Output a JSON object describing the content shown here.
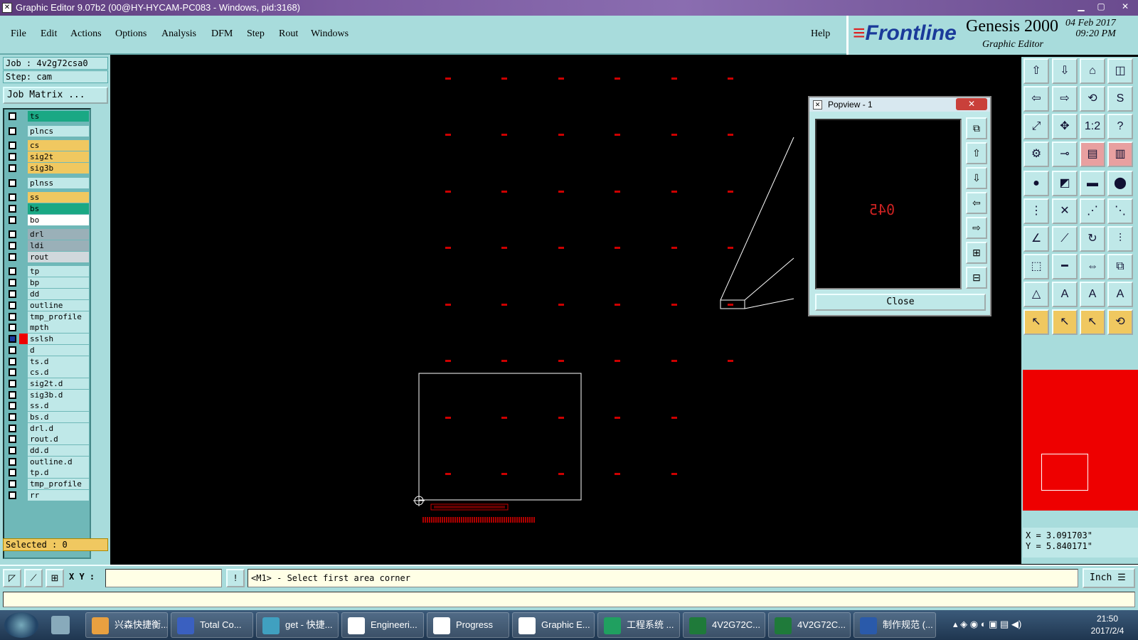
{
  "window": {
    "title": "Graphic Editor 9.07b2 (00@HY-HYCAM-PC083 - Windows, pid:3168)"
  },
  "menu": [
    "File",
    "Edit",
    "Actions",
    "Options",
    "Analysis",
    "DFM",
    "Step",
    "Rout",
    "Windows"
  ],
  "help_label": "Help",
  "brand": {
    "logo_prefix": "≡",
    "logo_text": "Frontline",
    "product": "Genesis 2000",
    "subtitle": "Graphic Editor",
    "date": "04 Feb 2017",
    "time": "09:20 PM"
  },
  "job": {
    "job_line": "Job : 4v2g72csa0",
    "step_line": "Step: cam",
    "matrix_button": "Job Matrix ..."
  },
  "layers": [
    {
      "name": "ts",
      "color": "#1aa884"
    },
    {
      "name": "plncs",
      "color": "#bfe8e8"
    },
    {
      "name": "cs",
      "color": "#f0c860"
    },
    {
      "name": "sig2t",
      "color": "#f0c860"
    },
    {
      "name": "sig3b",
      "color": "#f0c860"
    },
    {
      "name": "plnss",
      "color": "#bfe8e8"
    },
    {
      "name": "ss",
      "color": "#f0c860"
    },
    {
      "name": "bs",
      "color": "#1aa884"
    },
    {
      "name": "bo",
      "color": "#ffffff"
    },
    {
      "name": "drl",
      "color": "#9ab0b8"
    },
    {
      "name": "ldi",
      "color": "#9ab0b8"
    },
    {
      "name": "rout",
      "color": "#d0d8dc"
    },
    {
      "name": "tp",
      "color": "#bfe8e8"
    },
    {
      "name": "bp",
      "color": "#bfe8e8"
    },
    {
      "name": "dd",
      "color": "#bfe8e8"
    },
    {
      "name": "outline",
      "color": "#bfe8e8"
    },
    {
      "name": "tmp_profile",
      "color": "#bfe8e8"
    },
    {
      "name": "mpth",
      "color": "#bfe8e8"
    },
    {
      "name": "sslsh",
      "color": "#bfe8e8"
    },
    {
      "name": "d",
      "color": "#bfe8e8"
    },
    {
      "name": "ts.d",
      "color": "#bfe8e8"
    },
    {
      "name": "cs.d",
      "color": "#bfe8e8"
    },
    {
      "name": "sig2t.d",
      "color": "#bfe8e8"
    },
    {
      "name": "sig3b.d",
      "color": "#bfe8e8"
    },
    {
      "name": "ss.d",
      "color": "#bfe8e8"
    },
    {
      "name": "bs.d",
      "color": "#bfe8e8"
    },
    {
      "name": "drl.d",
      "color": "#bfe8e8"
    },
    {
      "name": "rout.d",
      "color": "#bfe8e8"
    },
    {
      "name": "dd.d",
      "color": "#bfe8e8"
    },
    {
      "name": "outline.d",
      "color": "#bfe8e8"
    },
    {
      "name": "tp.d",
      "color": "#bfe8e8"
    },
    {
      "name": "tmp_profile",
      "color": "#bfe8e8"
    },
    {
      "name": "rr",
      "color": "#bfe8e8"
    }
  ],
  "selected_text": "Selected : 0",
  "popview": {
    "title": "Popview - 1",
    "close_x": "✕",
    "preview_text": "045",
    "close_button": "Close"
  },
  "coords": {
    "x": "X = 3.091703\"",
    "y": "Y = 5.840171\""
  },
  "cmd": {
    "xy_label": "X Y :",
    "xy_value": "",
    "prompt": "<M1> - Select first area corner",
    "unit": "Inch ☰"
  },
  "taskbar": {
    "items": [
      {
        "label": "兴森快捷衡...",
        "color": "#e8a040"
      },
      {
        "label": "Total Co...",
        "color": "#3a60c0"
      },
      {
        "label": "get - 快捷...",
        "color": "#40a0c0"
      },
      {
        "label": "Engineeri...",
        "color": "#ffffff"
      },
      {
        "label": "Progress",
        "color": "#ffffff"
      },
      {
        "label": "Graphic E...",
        "color": "#ffffff"
      },
      {
        "label": "工程系统 ...",
        "color": "#20a060"
      },
      {
        "label": "4V2G72C...",
        "color": "#1f7a3a"
      },
      {
        "label": "4V2G72C...",
        "color": "#1f7a3a"
      },
      {
        "label": "制作规范 (...",
        "color": "#2a5aaa"
      }
    ],
    "clock_time": "21:50",
    "clock_date": "2017/2/4"
  },
  "colors": {
    "panel": "#a8dcdc",
    "pad": "#cc0000",
    "accent_orange": "#f0c860"
  }
}
